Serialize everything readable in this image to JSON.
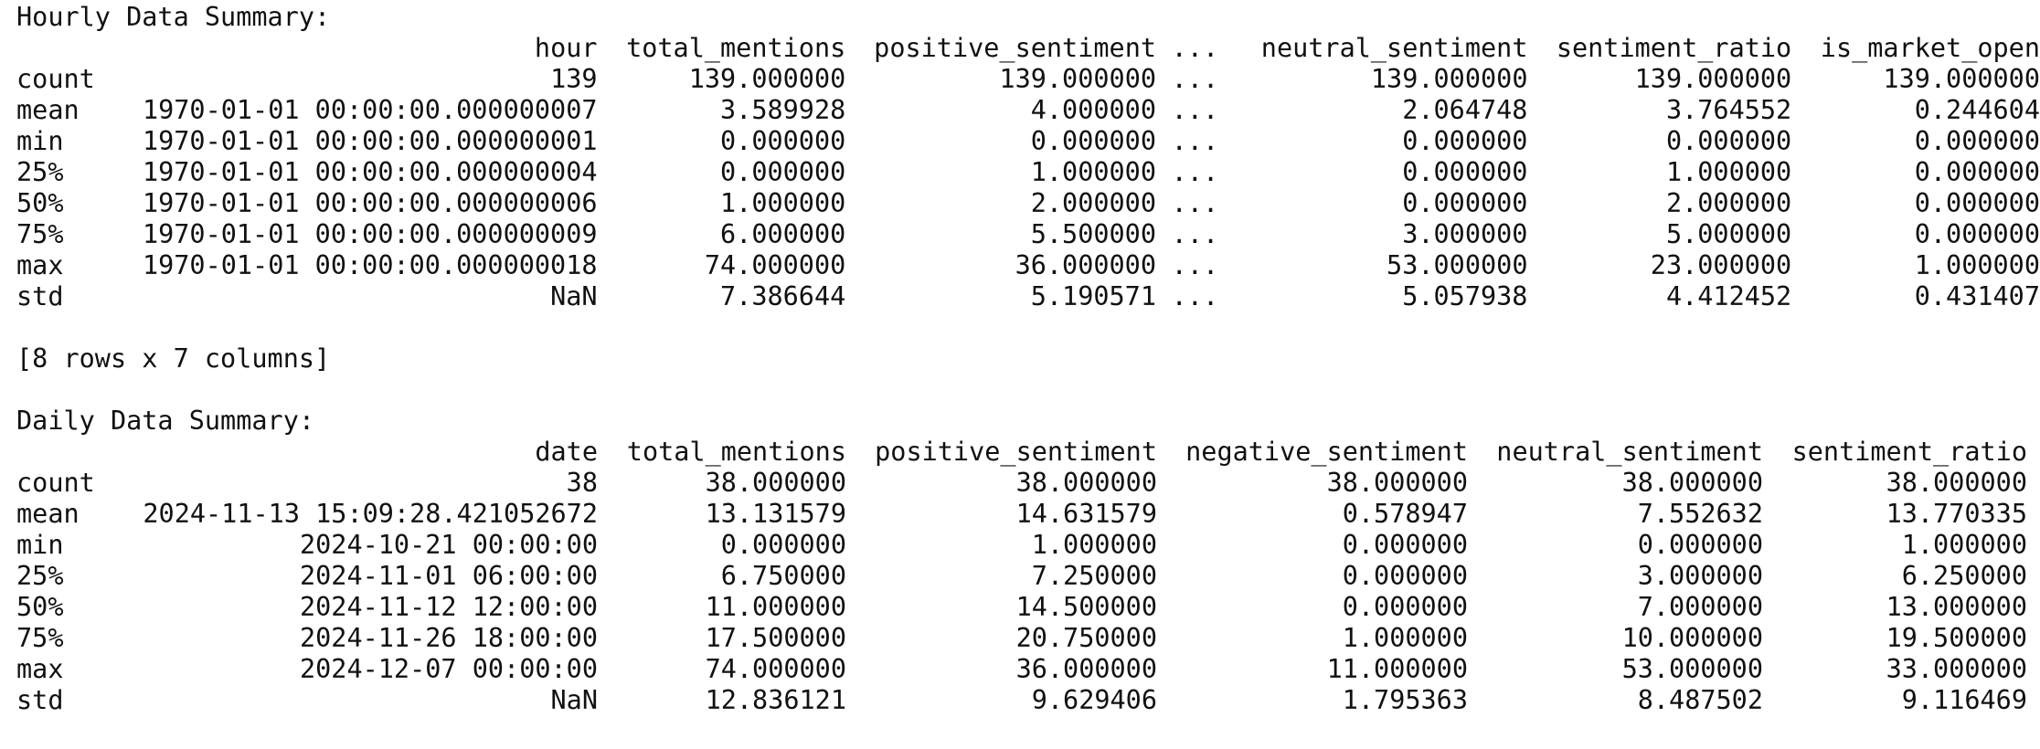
{
  "hourly": {
    "heading": "Hourly Data Summary:",
    "columns": [
      "hour",
      "total_mentions",
      "positive_sentiment",
      "...",
      "neutral_sentiment",
      "sentiment_ratio",
      "is_market_open"
    ],
    "rows": [
      [
        "count",
        "139",
        "139.000000",
        "139.000000",
        "...",
        "139.000000",
        "139.000000",
        "139.000000"
      ],
      [
        "mean",
        "1970-01-01 00:00:00.000000007",
        "3.589928",
        "4.000000",
        "...",
        "2.064748",
        "3.764552",
        "0.244604"
      ],
      [
        "min",
        "1970-01-01 00:00:00.000000001",
        "0.000000",
        "0.000000",
        "...",
        "0.000000",
        "0.000000",
        "0.000000"
      ],
      [
        "25%",
        "1970-01-01 00:00:00.000000004",
        "0.000000",
        "1.000000",
        "...",
        "0.000000",
        "1.000000",
        "0.000000"
      ],
      [
        "50%",
        "1970-01-01 00:00:00.000000006",
        "1.000000",
        "2.000000",
        "...",
        "0.000000",
        "2.000000",
        "0.000000"
      ],
      [
        "75%",
        "1970-01-01 00:00:00.000000009",
        "6.000000",
        "5.500000",
        "...",
        "3.000000",
        "5.000000",
        "0.000000"
      ],
      [
        "max",
        "1970-01-01 00:00:00.000000018",
        "74.000000",
        "36.000000",
        "...",
        "53.000000",
        "23.000000",
        "1.000000"
      ],
      [
        "std",
        "NaN",
        "7.386644",
        "5.190571",
        "...",
        "5.057938",
        "4.412452",
        "0.431407"
      ]
    ],
    "shape_note": "[8 rows x 7 columns]"
  },
  "daily": {
    "heading": "Daily Data Summary:",
    "columns": [
      "date",
      "total_mentions",
      "positive_sentiment",
      "negative_sentiment",
      "neutral_sentiment",
      "sentiment_ratio"
    ],
    "rows": [
      [
        "count",
        "38",
        "38.000000",
        "38.000000",
        "38.000000",
        "38.000000",
        "38.000000"
      ],
      [
        "mean",
        "2024-11-13 15:09:28.421052672",
        "13.131579",
        "14.631579",
        "0.578947",
        "7.552632",
        "13.770335"
      ],
      [
        "min",
        "2024-10-21 00:00:00",
        "0.000000",
        "1.000000",
        "0.000000",
        "0.000000",
        "1.000000"
      ],
      [
        "25%",
        "2024-11-01 06:00:00",
        "6.750000",
        "7.250000",
        "0.000000",
        "3.000000",
        "6.250000"
      ],
      [
        "50%",
        "2024-11-12 12:00:00",
        "11.000000",
        "14.500000",
        "0.000000",
        "7.000000",
        "13.000000"
      ],
      [
        "75%",
        "2024-11-26 18:00:00",
        "17.500000",
        "20.750000",
        "1.000000",
        "10.000000",
        "19.500000"
      ],
      [
        "max",
        "2024-12-07 00:00:00",
        "74.000000",
        "36.000000",
        "11.000000",
        "53.000000",
        "33.000000"
      ],
      [
        "std",
        "NaN",
        "12.836121",
        "9.629406",
        "1.795363",
        "8.487502",
        "9.116469"
      ]
    ]
  }
}
